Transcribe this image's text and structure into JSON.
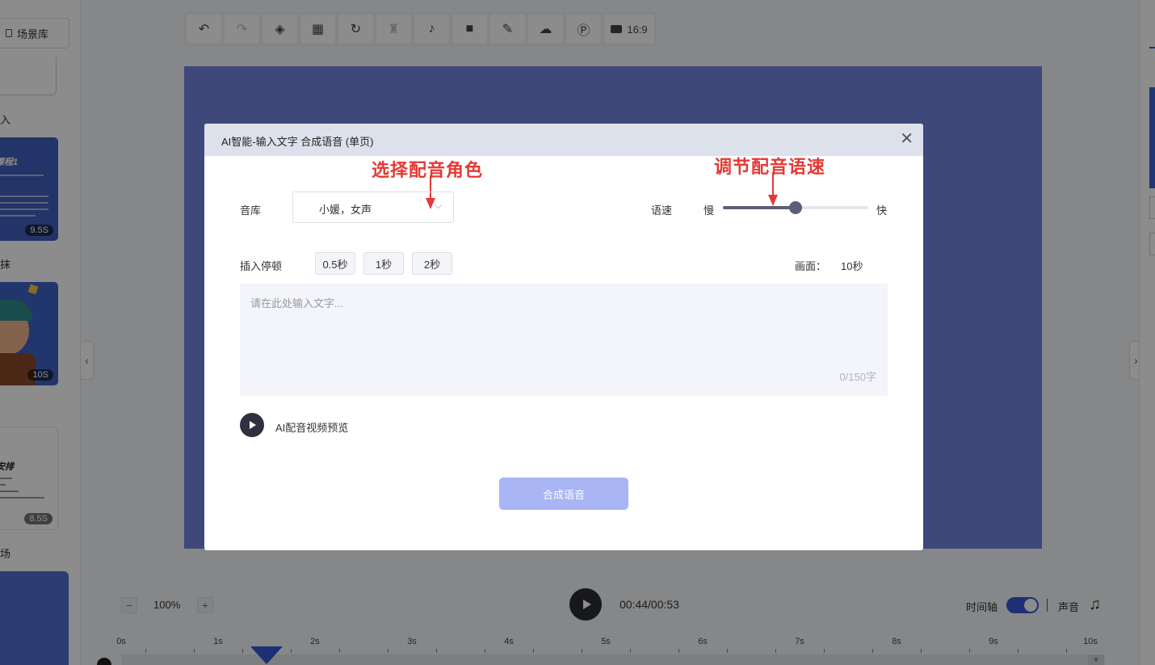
{
  "left_panel": {
    "scene_library_label": "场景库",
    "labels": [
      "入",
      "抹",
      "场"
    ],
    "thumbs": [
      {
        "title": "课程1",
        "duration": "9.5S"
      },
      {
        "duration": "10S"
      },
      {
        "title": "安排",
        "duration": "8.5S"
      }
    ]
  },
  "toolbar": {
    "icons": [
      "undo-icon",
      "redo-icon",
      "layers-icon",
      "grid-icon",
      "magnet-icon",
      "paint-icon",
      "microphone-icon",
      "camera-icon",
      "pen-icon",
      "cloud-icon",
      "p-icon"
    ],
    "ratio_label": "16:9"
  },
  "bottom_bar": {
    "zoom_minus": "−",
    "zoom_value": "100%",
    "zoom_plus": "+",
    "time": "00:44/00:53",
    "timeline_label": "时间轴",
    "sound_label": "声音",
    "timeline_on": true
  },
  "ruler": {
    "ticks": [
      "0s",
      "1s",
      "2s",
      "3s",
      "4s",
      "5s",
      "6s",
      "7s",
      "8s",
      "9s",
      "10s"
    ],
    "plus": "+"
  },
  "dialog": {
    "title": "AI智能-输入文字 合成语音 (单页)",
    "close": "✕",
    "voice_label": "音库",
    "voice_value": "小媛，女声",
    "speed_label": "语速",
    "speed_slow": "慢",
    "speed_fast": "快",
    "speed_level": 0.5,
    "pause_label": "插入停顿",
    "pause_options": [
      "0.5秒",
      "1秒",
      "2秒"
    ],
    "screen_label": "画面：",
    "screen_value": "10秒",
    "text_placeholder": "请在此处输入文字...",
    "char_count": "0/150字",
    "preview_label": "AI配音视频预览",
    "synth_button": "合成语音"
  },
  "annotations": {
    "select_voice": "选择配音角色",
    "adjust_speed": "调节配音语速",
    "color": "#e53935"
  },
  "colors": {
    "canvas": "#7384e0",
    "accent": "#3557d6",
    "synth_button": "#a9b5f5"
  }
}
